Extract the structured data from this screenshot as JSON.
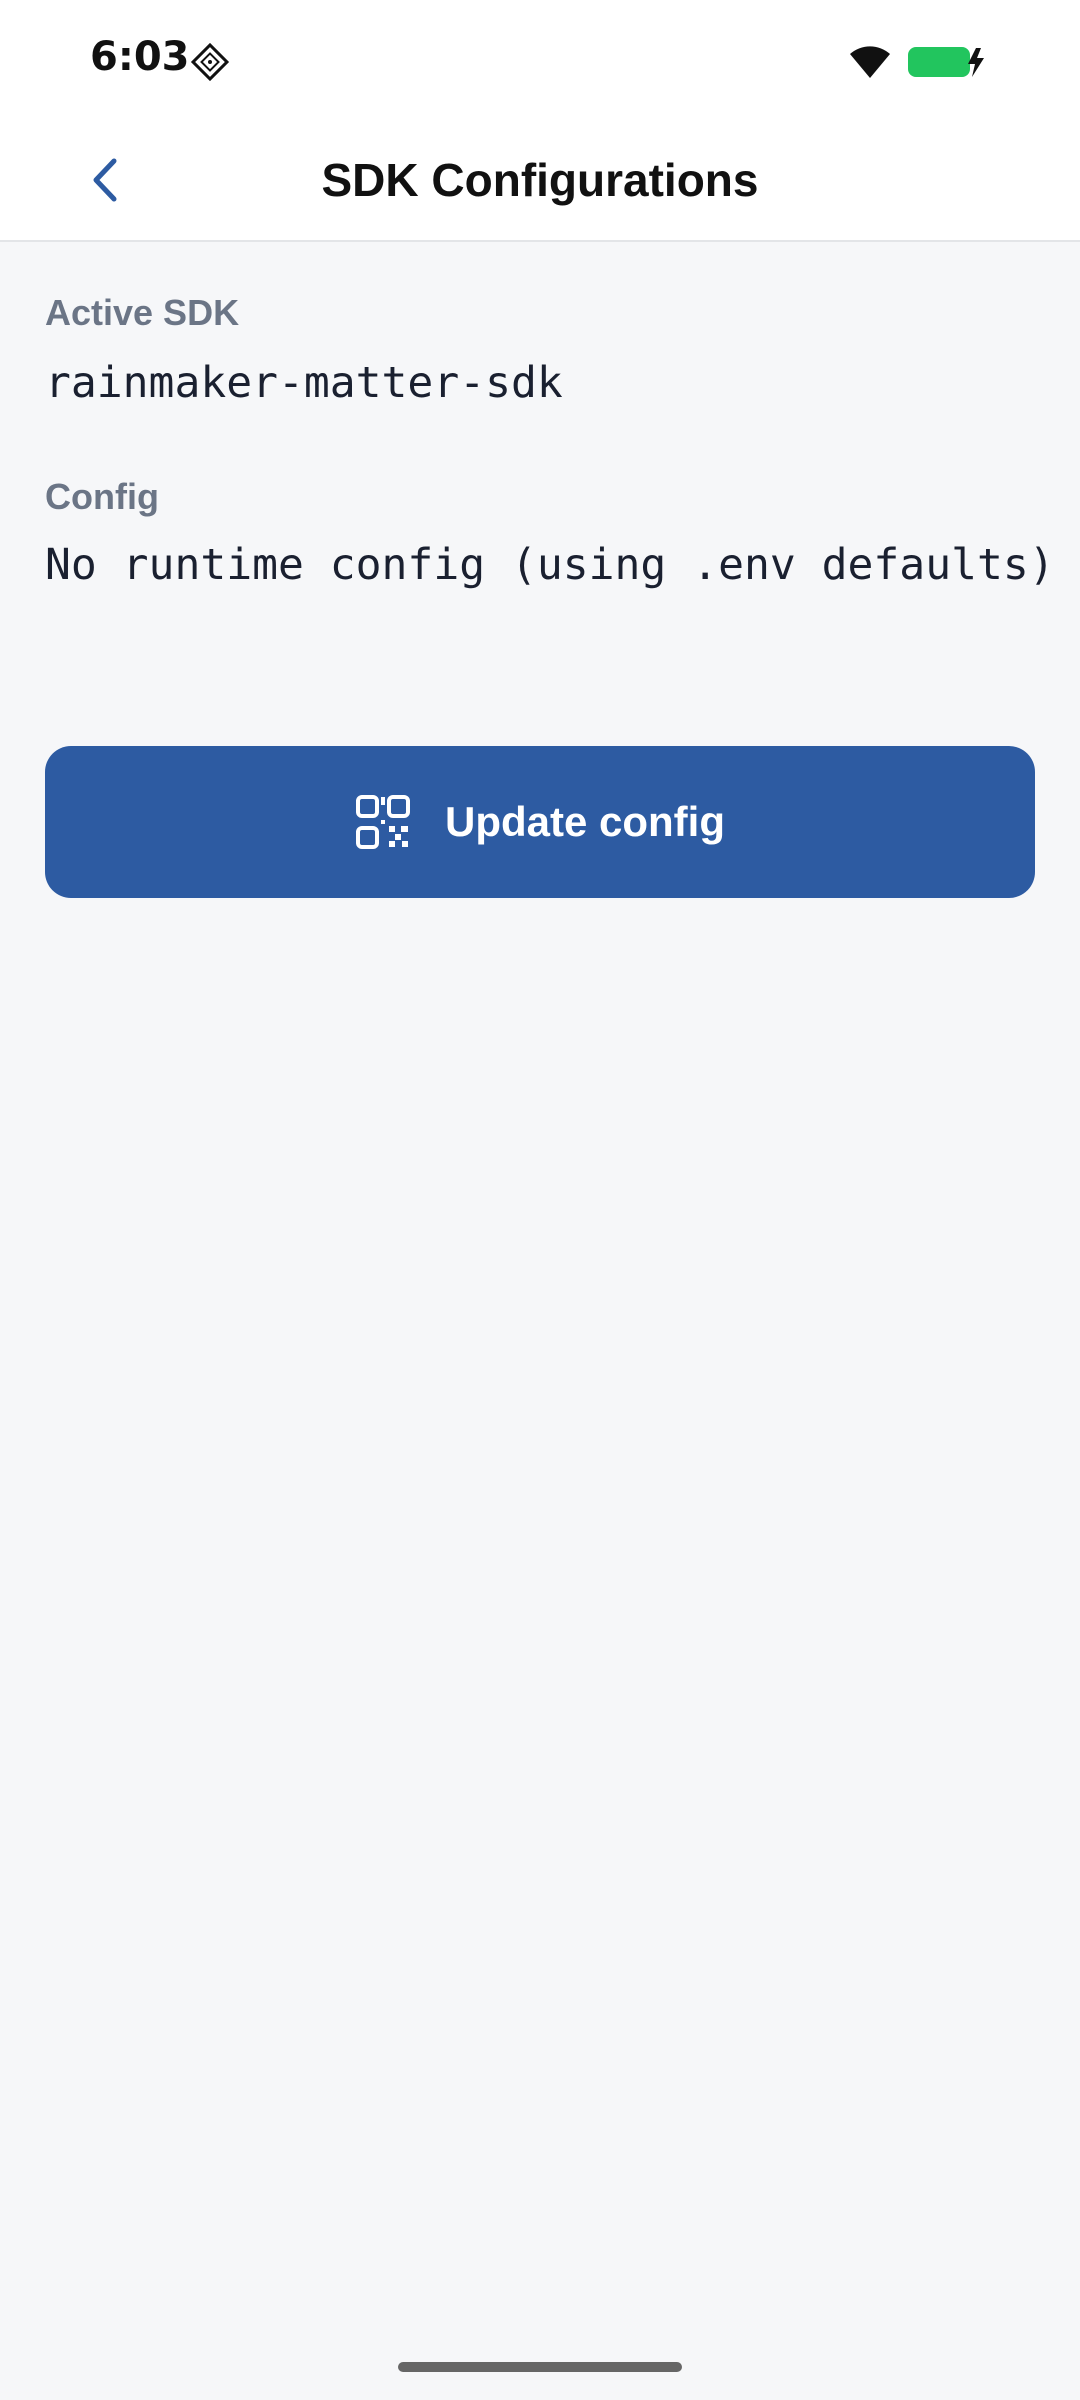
{
  "status_bar": {
    "time": "6:03",
    "icons": [
      "notification-icon",
      "wifi-icon",
      "battery-charging-icon"
    ],
    "battery_color": "#22c55e"
  },
  "header": {
    "title": "SDK Configurations",
    "back_icon": "chevron-left-icon"
  },
  "fields": {
    "active_sdk": {
      "label": "Active SDK",
      "value": "rainmaker-matter-sdk"
    },
    "config": {
      "label": "Config",
      "value": "No runtime config (using .env defaults)"
    }
  },
  "actions": {
    "update_config": {
      "label": "Update config",
      "icon": "qr-code-icon"
    }
  },
  "colors": {
    "accent": "#2d5ba2",
    "label": "#6b7586",
    "background": "#f6f7f9"
  }
}
